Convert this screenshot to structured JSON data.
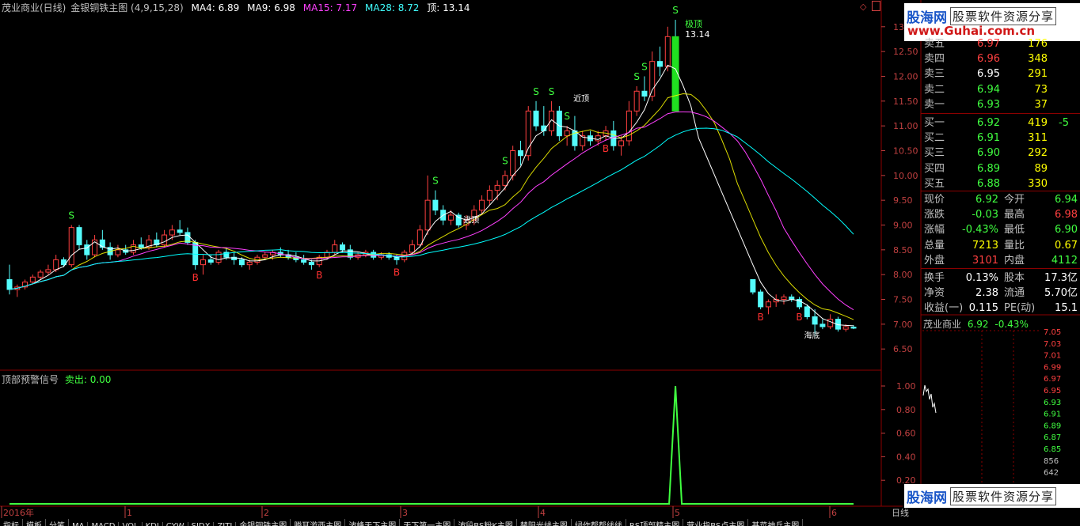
{
  "header": {
    "stock_title": "茂业商业(日线)",
    "indicator_name": "金银铜铁主图",
    "indicator_params": "(4,9,15,28)",
    "ma4_label": "MA4:",
    "ma4_value": "6.89",
    "ma9_label": "MA9:",
    "ma9_value": "6.98",
    "ma15_label": "MA15:",
    "ma15_value": "7.17",
    "ma28_label": "MA28:",
    "ma28_value": "8.72",
    "top_label": "顶:",
    "top_value": "13.14"
  },
  "colors": {
    "up": "#ff4040",
    "down": "#54fcfc",
    "ma4": "#ffffff",
    "ma9": "#ffff00",
    "ma15": "#ff40ff",
    "ma28": "#00ffff",
    "sell_line": "#40ff40",
    "grid": "#8b0000",
    "axis": "#c04040"
  },
  "price_axis": {
    "ticks": [
      "13",
      "12.50",
      "12.00",
      "11.50",
      "11.00",
      "10.50",
      "10.00",
      "9.50",
      "9.00",
      "8.50",
      "8.00",
      "7.50",
      "7.00",
      "6.50"
    ]
  },
  "sub_panel": {
    "title": "顶部预警信号",
    "sell_label": "卖出:",
    "sell_value": "0.00",
    "ticks": [
      "1.00",
      "0.80",
      "0.60",
      "0.40",
      "0.20"
    ]
  },
  "time_axis": {
    "labels": [
      "2016年",
      "1",
      "2",
      "3",
      "4",
      "5",
      "6"
    ],
    "mode": "日线"
  },
  "markers": {
    "peak": "极顶",
    "peak_value": "13.14",
    "near_top": "近顶",
    "near_top2": "逃顶",
    "bottom": "海底"
  },
  "quote": {
    "asks": [
      {
        "label": "卖五",
        "price": "6.97",
        "vol": "176"
      },
      {
        "label": "卖四",
        "price": "6.96",
        "vol": "348"
      },
      {
        "label": "卖三",
        "price": "6.95",
        "vol": "291"
      },
      {
        "label": "卖二",
        "price": "6.94",
        "vol": "73"
      },
      {
        "label": "卖一",
        "price": "6.93",
        "vol": "37"
      }
    ],
    "bids": [
      {
        "label": "买一",
        "price": "6.92",
        "vol": "419",
        "chg": "-5"
      },
      {
        "label": "买二",
        "price": "6.91",
        "vol": "311",
        "chg": ""
      },
      {
        "label": "买三",
        "price": "6.90",
        "vol": "292",
        "chg": ""
      },
      {
        "label": "买四",
        "price": "6.89",
        "vol": "89",
        "chg": ""
      },
      {
        "label": "买五",
        "price": "6.88",
        "vol": "330",
        "chg": ""
      }
    ],
    "stats": [
      {
        "l1": "现价",
        "v1": "6.92",
        "l2": "今开",
        "v2": "6.94"
      },
      {
        "l1": "涨跌",
        "v1": "-0.03",
        "l2": "最高",
        "v2": "6.98"
      },
      {
        "l1": "涨幅",
        "v1": "-0.43%",
        "l2": "最低",
        "v2": "6.90"
      },
      {
        "l1": "总量",
        "v1": "7213",
        "l2": "量比",
        "v2": "0.67"
      },
      {
        "l1": "外盘",
        "v1": "3101",
        "l2": "内盘",
        "v2": "4112"
      },
      {
        "l1": "换手",
        "v1": "0.13%",
        "l2": "股本",
        "v2": "17.3亿"
      },
      {
        "l1": "净资",
        "v1": "2.38",
        "l2": "流通",
        "v2": "5.70亿"
      },
      {
        "l1": "收益(一)",
        "v1": "0.115",
        "l2": "PE(动)",
        "v2": "15.1"
      }
    ],
    "mini_title": "茂业商业",
    "mini_price": "6.92",
    "mini_pct": "-0.43%",
    "mini_ticks": [
      "7.05",
      "7.03",
      "7.01",
      "6.99",
      "6.97",
      "6.95",
      "6.93",
      "6.91",
      "6.89",
      "6.87",
      "6.85",
      "856",
      "642"
    ]
  },
  "watermark": {
    "brand": "股海网",
    "tag": "股票软件资源分享",
    "url": "www.Guhai.com.cn"
  },
  "tabs": [
    "指标",
    "模板",
    "分笔",
    "MA",
    "MACD",
    "VOL",
    "KDJ",
    "CYW",
    "SJDX",
    "ZJTJ",
    "金银铜铁主图",
    "腾耳游西主图",
    "波峰天下主图",
    "天下第一主图",
    "波段BS粉K主图",
    "替阳光线主图",
    "绿作帮帮线线",
    "RS顶部精主图",
    "营业指BS点主图",
    "基菜神兵主图"
  ],
  "chart_data": {
    "type": "candlestick",
    "title": "茂业商业(日线) 金银铜铁主图",
    "x_labels": [
      "2016年",
      "1",
      "2",
      "3",
      "4",
      "5",
      "6"
    ],
    "ylim": [
      6.2,
      13.3
    ],
    "ohlc": [
      [
        7.9,
        8.2,
        7.6,
        7.7
      ],
      [
        7.7,
        7.8,
        7.55,
        7.75
      ],
      [
        7.75,
        7.9,
        7.7,
        7.85
      ],
      [
        7.85,
        8.0,
        7.8,
        7.95
      ],
      [
        7.95,
        8.1,
        7.9,
        8.05
      ],
      [
        8.05,
        8.2,
        8.0,
        8.1
      ],
      [
        8.1,
        8.4,
        8.05,
        8.3
      ],
      [
        8.3,
        8.35,
        8.15,
        8.2
      ],
      [
        8.2,
        9.0,
        8.15,
        8.95
      ],
      [
        8.95,
        9.0,
        8.5,
        8.6
      ],
      [
        8.6,
        8.7,
        8.3,
        8.4
      ],
      [
        8.4,
        8.8,
        8.35,
        8.7
      ],
      [
        8.7,
        8.9,
        8.5,
        8.55
      ],
      [
        8.55,
        8.65,
        8.3,
        8.4
      ],
      [
        8.4,
        8.6,
        8.35,
        8.5
      ],
      [
        8.5,
        8.6,
        8.4,
        8.45
      ],
      [
        8.45,
        8.7,
        8.4,
        8.6
      ],
      [
        8.6,
        8.75,
        8.5,
        8.55
      ],
      [
        8.55,
        8.8,
        8.5,
        8.7
      ],
      [
        8.7,
        8.85,
        8.55,
        8.6
      ],
      [
        8.6,
        8.9,
        8.55,
        8.8
      ],
      [
        8.8,
        9.0,
        8.7,
        8.9
      ],
      [
        8.9,
        9.1,
        8.8,
        8.85
      ],
      [
        8.85,
        8.95,
        8.6,
        8.65
      ],
      [
        8.65,
        8.7,
        8.1,
        8.2
      ],
      [
        8.2,
        8.4,
        8.0,
        8.3
      ],
      [
        8.3,
        8.4,
        8.2,
        8.25
      ],
      [
        8.25,
        8.5,
        8.2,
        8.45
      ],
      [
        8.45,
        8.55,
        8.3,
        8.35
      ],
      [
        8.35,
        8.45,
        8.2,
        8.3
      ],
      [
        8.3,
        8.35,
        8.15,
        8.2
      ],
      [
        8.2,
        8.3,
        8.1,
        8.25
      ],
      [
        8.25,
        8.4,
        8.2,
        8.35
      ],
      [
        8.35,
        8.45,
        8.3,
        8.4
      ],
      [
        8.4,
        8.5,
        8.3,
        8.45
      ],
      [
        8.45,
        8.55,
        8.35,
        8.4
      ],
      [
        8.4,
        8.5,
        8.3,
        8.35
      ],
      [
        8.35,
        8.45,
        8.25,
        8.3
      ],
      [
        8.3,
        8.4,
        8.2,
        8.25
      ],
      [
        8.25,
        8.3,
        8.1,
        8.2
      ],
      [
        8.2,
        8.4,
        8.15,
        8.35
      ],
      [
        8.35,
        8.5,
        8.3,
        8.45
      ],
      [
        8.45,
        8.7,
        8.4,
        8.6
      ],
      [
        8.6,
        8.65,
        8.45,
        8.5
      ],
      [
        8.5,
        8.6,
        8.3,
        8.35
      ],
      [
        8.35,
        8.45,
        8.3,
        8.4
      ],
      [
        8.4,
        8.5,
        8.35,
        8.45
      ],
      [
        8.45,
        8.5,
        8.3,
        8.35
      ],
      [
        8.35,
        8.45,
        8.3,
        8.4
      ],
      [
        8.4,
        8.45,
        8.3,
        8.35
      ],
      [
        8.35,
        8.4,
        8.2,
        8.3
      ],
      [
        8.3,
        8.5,
        8.25,
        8.45
      ],
      [
        8.45,
        8.7,
        8.4,
        8.6
      ],
      [
        8.6,
        9.0,
        8.55,
        8.9
      ],
      [
        8.9,
        10.0,
        8.8,
        9.5
      ],
      [
        9.5,
        9.7,
        9.2,
        9.3
      ],
      [
        9.3,
        9.4,
        9.0,
        9.1
      ],
      [
        9.1,
        9.3,
        9.0,
        9.2
      ],
      [
        9.2,
        9.25,
        8.95,
        9.0
      ],
      [
        9.0,
        9.2,
        8.9,
        9.1
      ],
      [
        9.1,
        9.4,
        9.0,
        9.3
      ],
      [
        9.3,
        9.6,
        9.2,
        9.5
      ],
      [
        9.5,
        9.8,
        9.4,
        9.7
      ],
      [
        9.7,
        9.9,
        9.5,
        9.8
      ],
      [
        9.8,
        10.1,
        9.7,
        10.0
      ],
      [
        10.0,
        10.6,
        9.9,
        10.5
      ],
      [
        10.5,
        10.7,
        10.2,
        10.4
      ],
      [
        10.4,
        11.4,
        10.3,
        11.3
      ],
      [
        11.3,
        11.5,
        10.9,
        11.0
      ],
      [
        11.0,
        11.4,
        10.8,
        10.9
      ],
      [
        10.9,
        11.5,
        10.8,
        11.3
      ],
      [
        11.3,
        11.4,
        10.7,
        10.8
      ],
      [
        10.8,
        11.0,
        10.6,
        10.9
      ],
      [
        10.9,
        11.2,
        10.5,
        10.6
      ],
      [
        10.6,
        10.9,
        10.5,
        10.8
      ],
      [
        10.8,
        10.9,
        10.6,
        10.7
      ],
      [
        10.7,
        10.9,
        10.6,
        10.8
      ],
      [
        10.8,
        11.0,
        10.7,
        10.9
      ],
      [
        10.9,
        11.1,
        10.5,
        10.6
      ],
      [
        10.6,
        10.8,
        10.4,
        10.7
      ],
      [
        10.7,
        11.5,
        10.6,
        11.3
      ],
      [
        11.3,
        11.8,
        11.2,
        11.7
      ],
      [
        11.7,
        12.0,
        11.5,
        11.6
      ],
      [
        11.6,
        12.5,
        11.5,
        12.3
      ],
      [
        12.3,
        12.6,
        12.0,
        12.2
      ],
      [
        12.2,
        13.0,
        12.1,
        12.8
      ],
      [
        12.8,
        13.14,
        11.3,
        11.3
      ],
      [
        null,
        null,
        null,
        null
      ],
      [
        null,
        null,
        null,
        null
      ],
      [
        null,
        null,
        null,
        null
      ],
      [
        null,
        null,
        null,
        null
      ],
      [
        null,
        null,
        null,
        null
      ],
      [
        null,
        null,
        null,
        null
      ],
      [
        null,
        null,
        null,
        null
      ],
      [
        null,
        null,
        null,
        null
      ],
      [
        null,
        null,
        null,
        null
      ],
      [
        7.9,
        7.9,
        7.6,
        7.65
      ],
      [
        7.65,
        7.7,
        7.3,
        7.35
      ],
      [
        7.35,
        7.5,
        7.2,
        7.45
      ],
      [
        7.45,
        7.6,
        7.35,
        7.5
      ],
      [
        7.5,
        7.6,
        7.4,
        7.55
      ],
      [
        7.55,
        7.6,
        7.45,
        7.5
      ],
      [
        7.5,
        7.55,
        7.3,
        7.35
      ],
      [
        7.35,
        7.4,
        7.1,
        7.15
      ],
      [
        7.15,
        7.3,
        6.75,
        7.0
      ],
      [
        7.0,
        7.1,
        6.9,
        6.95
      ],
      [
        6.95,
        7.2,
        6.9,
        7.1
      ],
      [
        7.1,
        7.15,
        6.85,
        6.9
      ],
      [
        6.9,
        7.0,
        6.85,
        6.95
      ],
      [
        6.94,
        6.98,
        6.9,
        6.92
      ]
    ],
    "sell_signal": {
      "name": "卖出",
      "ylim": [
        0,
        1
      ],
      "values_note": "single spike at peak candle",
      "spike_index": 86,
      "spike_value": 1.0
    }
  }
}
